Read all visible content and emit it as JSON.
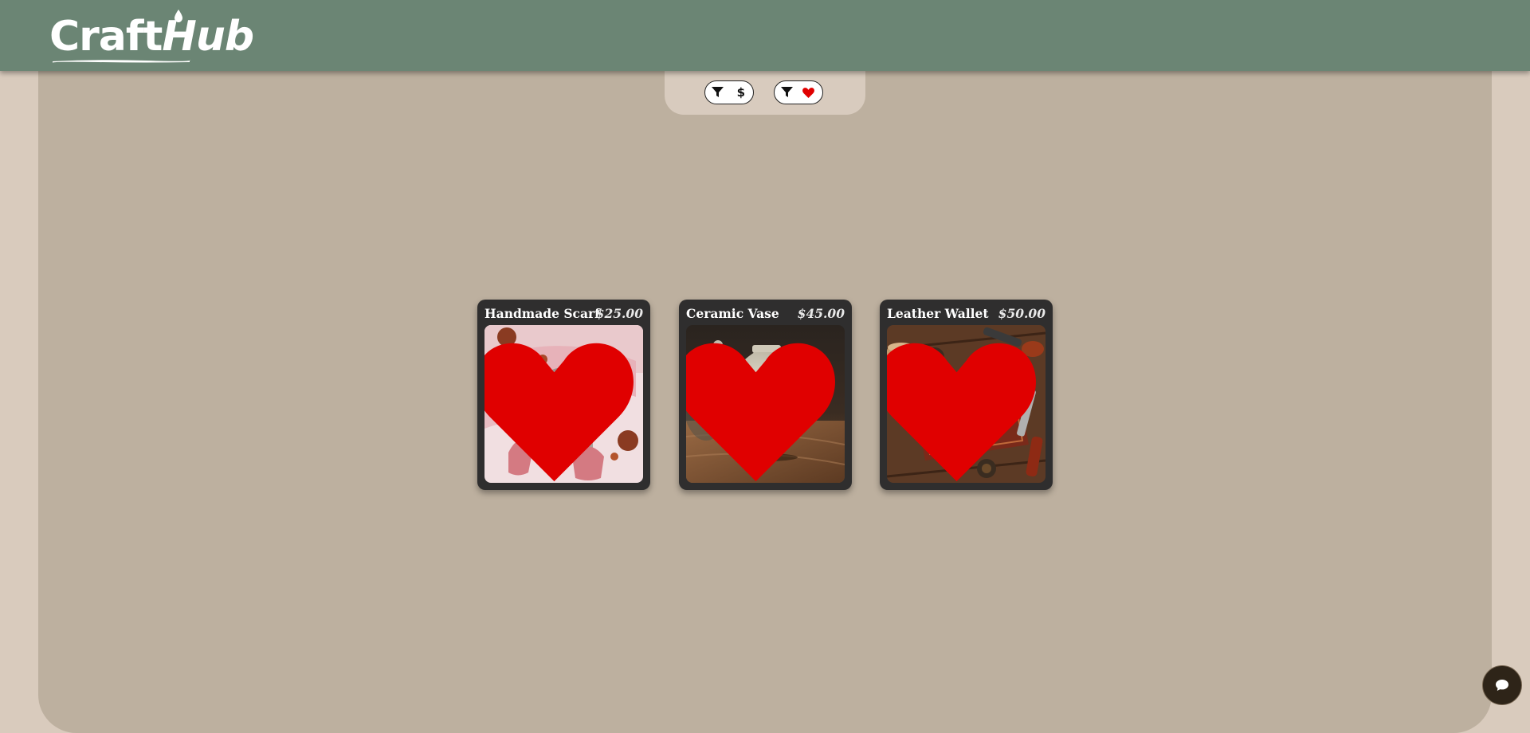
{
  "header": {
    "logo_text_craft": "Craft",
    "logo_text_hub": "Hub",
    "logo_icon": "craft-hub-logo"
  },
  "filters": [
    {
      "icon_left": "filter-icon",
      "icon_right": "dollar-icon",
      "symbol": "$"
    },
    {
      "icon_left": "filter-icon",
      "icon_right": "heart-icon"
    }
  ],
  "products": [
    {
      "title": "Handmade Scarf",
      "price": "$25.00",
      "favorited": true,
      "image": "knitted-fox-scarf"
    },
    {
      "title": "Ceramic Vase",
      "price": "$45.00",
      "favorited": true,
      "image": "ceramic-vase"
    },
    {
      "title": "Leather Wallet",
      "price": "$50.00",
      "favorited": true,
      "image": "tooled-leather-wallet"
    }
  ],
  "chat": {
    "icon": "chat-bubble-icon"
  },
  "colors": {
    "header_bg": "#6b8574",
    "page_bg": "#d9cbbd",
    "main_bg": "#bdb09f",
    "card_bg": "#2f2e2e",
    "heart": "#e00000",
    "chat_bg": "#2e2418"
  }
}
